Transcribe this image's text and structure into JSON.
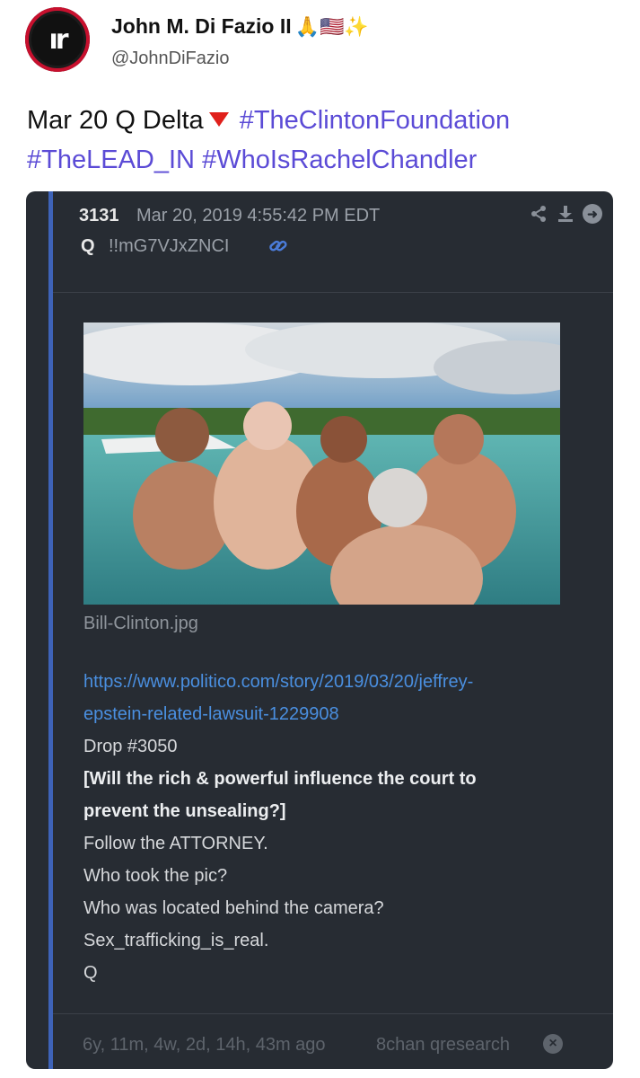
{
  "tweet": {
    "author_name": "John M. Di Fazio II",
    "author_emojis": "🙏🇺🇸✨",
    "handle": "@JohnDiFazio",
    "text_prefix": "Mar 20 Q Delta",
    "hashtags": [
      "#TheClintonFoundation",
      "#TheLEAD_IN",
      "#WhoIsRachelChandler"
    ],
    "avatar_icon": "logo-icon"
  },
  "card": {
    "post_number": "3131",
    "date": "Mar 20, 2019 4:55:42 PM EDT",
    "author": "Q",
    "tripcode": "!!mG7VJxZNCI",
    "icons": [
      "share-icon",
      "download-icon",
      "forward-icon",
      "link-icon"
    ],
    "image_filename": "Bill-Clinton.jpg",
    "url_line1": "https://www.politico.com/story/2019/03/20/jeffrey-",
    "url_line2": "epstein-related-lawsuit-1229908",
    "drop_ref": "Drop #3050",
    "bold_line1": "[Will the rich & powerful influence the court to",
    "bold_line2": "prevent the unsealing?]",
    "line1": "Follow the ATTORNEY.",
    "line2": "Who took the pic?",
    "line3": "Who was located behind the camera?",
    "line4": "Sex_trafficking_is_real.",
    "signature": "Q",
    "time_ago": "6y, 11m, 4w, 2d, 14h, 43m ago",
    "board": "8chan qresearch"
  },
  "colors": {
    "hashtag": "#5b4bd6",
    "card_bg": "#272c33",
    "accent": "#3e63b8",
    "link": "#4a8fe0"
  }
}
